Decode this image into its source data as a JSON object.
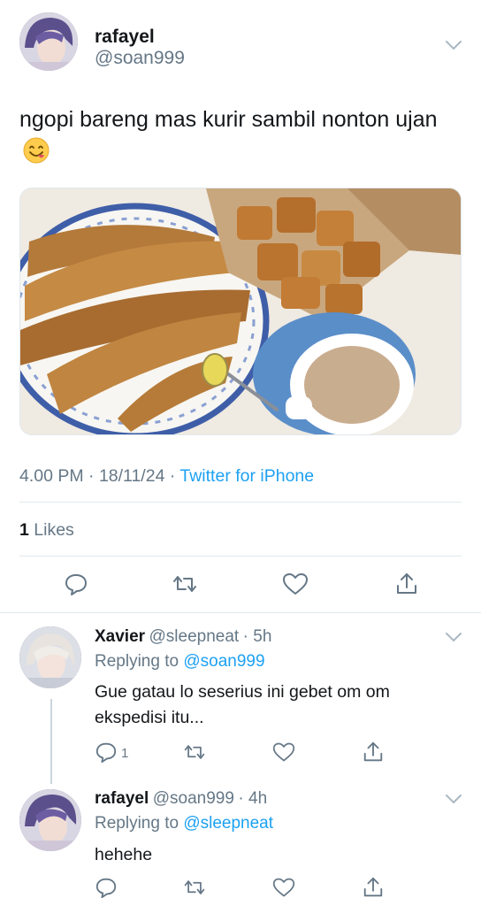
{
  "tweet": {
    "author_name": "rafayel",
    "author_handle": "@soan999",
    "text": "ngopi bareng mas kurir sambil nonton ujan",
    "emoji": "yum-face-emoji",
    "timestamp": "4.00 PM · 18/11/24 · ",
    "source": "Twitter for iPhone",
    "likes_count": "1",
    "likes_label": " Likes",
    "photo_icon": "food-photo"
  },
  "replies": [
    {
      "author_name": "Xavier",
      "author_handle": "@sleepneat",
      "time": "· 5h",
      "replying_prefix": "Replying to ",
      "replying_to": "@soan999",
      "text": "Gue gatau lo seserius ini gebet om om ekspedisi itu...",
      "reply_count": "1"
    },
    {
      "author_name": "rafayel",
      "author_handle": "@soan999",
      "time": "· 4h",
      "replying_prefix": "Replying to ",
      "replying_to": "@sleepneat",
      "text": "hehehe",
      "reply_count": ""
    }
  ],
  "colors": {
    "accent": "#1da1f2",
    "secondary_text": "#657786",
    "divider": "#e1e8ed"
  },
  "icons": [
    "reply-icon",
    "retweet-icon",
    "like-icon",
    "share-icon",
    "chevron-down-icon"
  ]
}
